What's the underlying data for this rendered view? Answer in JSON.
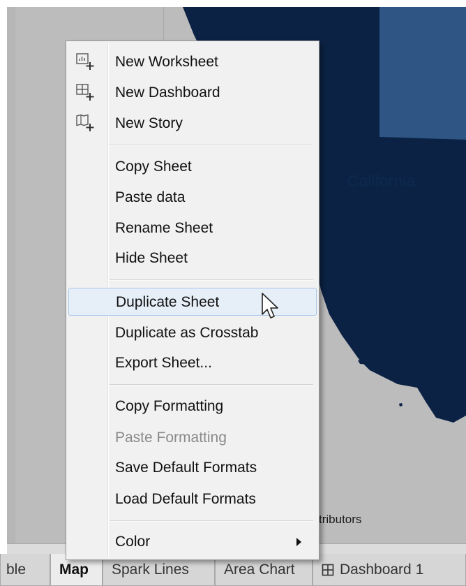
{
  "map": {
    "state_label": "California",
    "attribution": "tributors",
    "colors": {
      "background": "#bcbcbc",
      "land": "#0b2244",
      "highlight": "#2e5583"
    }
  },
  "tabs": [
    {
      "label": "ble",
      "active": false
    },
    {
      "label": "Map",
      "active": true
    },
    {
      "label": "Spark Lines",
      "active": false
    },
    {
      "label": "Area Chart",
      "active": false
    },
    {
      "label": "Dashboard 1",
      "active": false,
      "icon": "dashboard-icon"
    }
  ],
  "menu": {
    "items": [
      {
        "label": "New Worksheet",
        "icon": "new-worksheet-icon"
      },
      {
        "label": "New Dashboard",
        "icon": "new-dashboard-icon"
      },
      {
        "label": "New Story",
        "icon": "new-story-icon"
      },
      {
        "label": "Copy Sheet"
      },
      {
        "label": "Paste data"
      },
      {
        "label": "Rename Sheet"
      },
      {
        "label": "Hide Sheet"
      },
      {
        "label": "Duplicate Sheet",
        "highlighted": true
      },
      {
        "label": "Duplicate as Crosstab"
      },
      {
        "label": "Export Sheet..."
      },
      {
        "label": "Copy Formatting"
      },
      {
        "label": "Paste Formatting",
        "disabled": true
      },
      {
        "label": "Save Default Formats"
      },
      {
        "label": "Load Default Formats"
      },
      {
        "label": "Color",
        "submenu": true
      }
    ]
  }
}
